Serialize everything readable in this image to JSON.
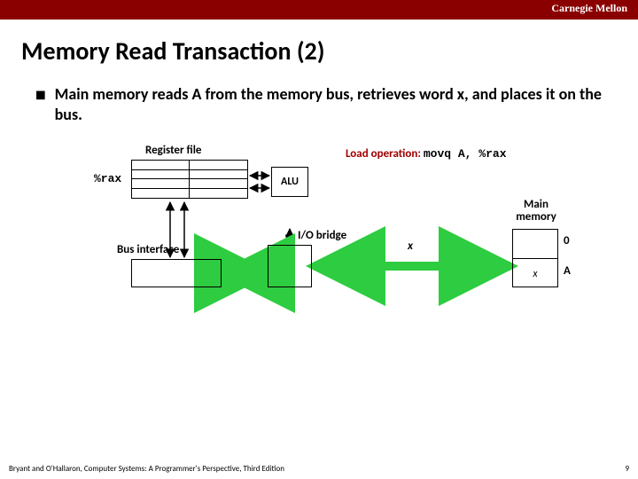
{
  "header": {
    "brand": "Carnegie Mellon"
  },
  "title": "Memory Read Transaction (2)",
  "bullet": "Main memory reads A from the memory bus, retrieves word x, and places it on the bus.",
  "diagram": {
    "register_file_label": "Register file",
    "rax_label": "%rax",
    "alu_label": "ALU",
    "load_op_prefix": "Load operation:",
    "load_op_code": "movq A, %rax",
    "io_bridge_label": "I/O bridge",
    "bus_interface_label": "Bus interface",
    "main_memory_label": "Main memory",
    "bus_value": "x",
    "mem_cell0": "",
    "mem_cell1": "x",
    "mem_addr0": "0",
    "mem_addr1": "A"
  },
  "footer": {
    "cite": "Bryant and O'Hallaron, Computer Systems: A Programmer's Perspective, Third Edition",
    "page": "9"
  }
}
